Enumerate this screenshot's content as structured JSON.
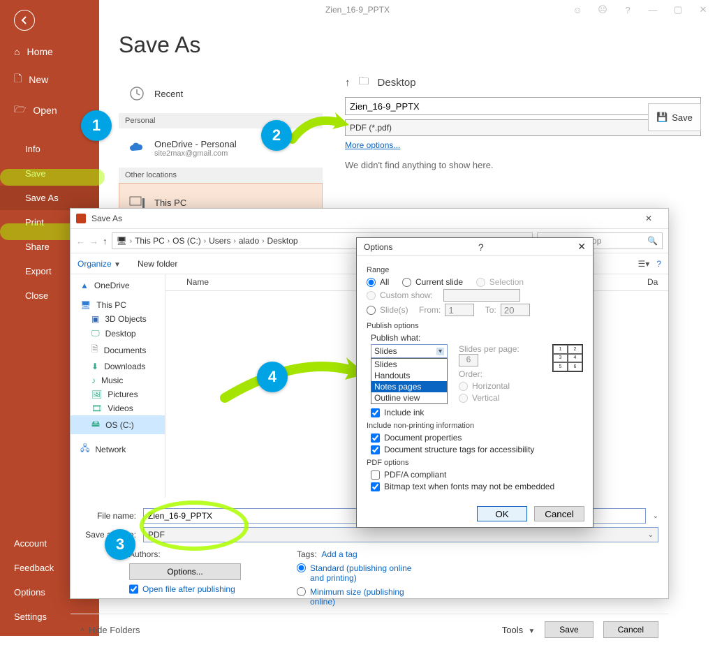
{
  "window": {
    "title": "Zien_16-9_PPTX"
  },
  "redbar": {
    "home": "Home",
    "new": "New",
    "open": "Open",
    "info": "Info",
    "save": "Save",
    "saveas": "Save As",
    "print": "Print",
    "share": "Share",
    "export": "Export",
    "close": "Close",
    "account": "Account",
    "feedback": "Feedback",
    "options": "Options",
    "settings": "Settings"
  },
  "backstage": {
    "heading": "Save As",
    "recent": "Recent",
    "personal_header": "Personal",
    "onedrive": "OneDrive - Personal",
    "onedrive_email": "site2max@gmail.com",
    "other_header": "Other locations",
    "thispc": "This PC",
    "breadcrumb": "Desktop",
    "filename": "Zien_16-9_PPTX",
    "filetype": "PDF (*.pdf)",
    "more": "More options...",
    "save_btn": "Save",
    "empty": "We didn't find anything to show here."
  },
  "filedlg": {
    "title": "Save As",
    "path": [
      "This PC",
      "OS (C:)",
      "Users",
      "alado",
      "Desktop"
    ],
    "search_placeholder": "Search Desktop",
    "organize": "Organize",
    "newfolder": "New folder",
    "tree": {
      "onedrive": "OneDrive",
      "thispc": "This PC",
      "objects3d": "3D Objects",
      "desktop": "Desktop",
      "documents": "Documents",
      "downloads": "Downloads",
      "music": "Music",
      "pictures": "Pictures",
      "videos": "Videos",
      "osc": "OS (C:)",
      "network": "Network"
    },
    "cols": {
      "name": "Name",
      "date": "Da"
    },
    "filename_label": "File name:",
    "filename": "Zien_16-9_PPTX",
    "savetype_label": "Save as type:",
    "savetype": "PDF",
    "authors_label": "Authors:",
    "options_btn": "Options...",
    "open_after": "Open file after publishing",
    "tags_label": "Tags:",
    "add_tag": "Add a tag",
    "opt_standard": "Standard (publishing online and printing)",
    "opt_min": "Minimum size (publishing online)",
    "hide_folders": "Hide Folders",
    "tools": "Tools",
    "save": "Save",
    "cancel": "Cancel"
  },
  "optdlg": {
    "title": "Options",
    "range": "Range",
    "all": "All",
    "current": "Current slide",
    "selection": "Selection",
    "custom": "Custom show:",
    "slides": "Slide(s)",
    "from": "From:",
    "from_v": "1",
    "to": "To:",
    "to_v": "20",
    "publish_options": "Publish options",
    "publish_what": "Publish what:",
    "publish_sel": "Slides",
    "dd": {
      "slides": "Slides",
      "handouts": "Handouts",
      "notes": "Notes pages",
      "outline": "Outline view"
    },
    "slides_per": "Slides per page:",
    "slides_per_v": "6",
    "order": "Order:",
    "horiz": "Horizontal",
    "vert": "Vertical",
    "include_ink": "Include ink",
    "nonprint": "Include non-printing information",
    "docprops": "Document properties",
    "docstruct": "Document structure tags for accessibility",
    "pdfopts": "PDF options",
    "pdfa": "PDF/A compliant",
    "bitmap": "Bitmap text when fonts may not be embedded",
    "ok": "OK",
    "cancel": "Cancel"
  },
  "badges": {
    "b1": "1",
    "b2": "2",
    "b3": "3",
    "b4": "4"
  }
}
